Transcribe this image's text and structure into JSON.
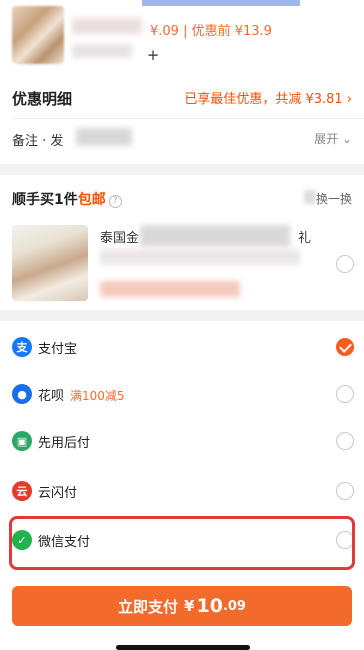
{
  "product": {
    "price_line": "¥.09 | 优惠前 ¥13.9",
    "quantity_plus": "+"
  },
  "discount": {
    "title": "优惠明细",
    "summary": "已享最佳优惠，共减 ¥3.81 ›"
  },
  "remark": {
    "label": "备注 · 发",
    "expand": "展开 ⌄"
  },
  "addon": {
    "title": "顺手买1件",
    "free_shipping": "包邮",
    "help_glyph": "?",
    "swap": "换一换",
    "name_start": "泰国金",
    "name_end": "礼"
  },
  "payment": {
    "methods": [
      {
        "label": "支付宝",
        "promo": "",
        "icon": "alipay-icon",
        "icon_glyph": "支",
        "color": "#1677ff",
        "selected": true
      },
      {
        "label": "花呗",
        "promo": "满100减5",
        "icon": "huabei-icon",
        "icon_glyph": "●",
        "color": "#1a6fe8",
        "selected": false
      },
      {
        "label": "先用后付",
        "promo": "",
        "icon": "pay-later-icon",
        "icon_glyph": "▣",
        "color": "#2aa866",
        "selected": false
      },
      {
        "label": "云闪付",
        "promo": "",
        "icon": "unionpay-icon",
        "icon_glyph": "云",
        "color": "#e23c2b",
        "selected": false
      },
      {
        "label": "微信支付",
        "promo": "",
        "icon": "wechat-pay-icon",
        "icon_glyph": "✓",
        "color": "#22b14c",
        "selected": false
      }
    ]
  },
  "submit": {
    "label": "立即支付",
    "currency": "¥",
    "amount_int": "10",
    "amount_dec": ".09"
  },
  "colors": {
    "accent": "#ff5000",
    "button": "#f26a2c",
    "highlight_border": "#e0393c"
  }
}
